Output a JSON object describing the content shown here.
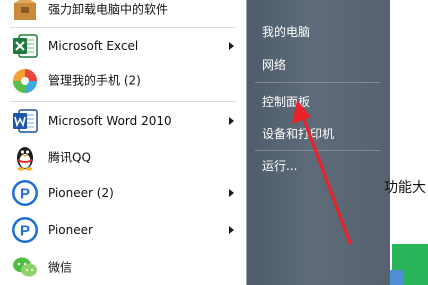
{
  "programs": [
    {
      "label": "强力卸载电脑中的软件",
      "icon": "uninstaller-box-icon",
      "has_arrow": false
    },
    {
      "label": "Microsoft Excel",
      "icon": "excel-icon",
      "has_arrow": true
    },
    {
      "label": "管理我的手机 (2)",
      "icon": "phone-manager-icon",
      "has_arrow": false
    },
    {
      "label": "Microsoft Word 2010",
      "icon": "word-icon",
      "has_arrow": true
    },
    {
      "label": "腾讯QQ",
      "icon": "qq-penguin-icon",
      "has_arrow": false
    },
    {
      "label": "Pioneer (2)",
      "icon": "pioneer-icon",
      "has_arrow": true
    },
    {
      "label": "Pioneer",
      "icon": "pioneer-icon",
      "has_arrow": true
    },
    {
      "label": "微信",
      "icon": "wechat-icon",
      "has_arrow": false
    }
  ],
  "right_menu": [
    {
      "label": "我的电脑"
    },
    {
      "label": "网络"
    },
    {
      "label": "控制面板"
    },
    {
      "label": "设备和打印机"
    },
    {
      "label": "运行..."
    }
  ],
  "background_doc": {
    "text": "功能大"
  },
  "colors": {
    "annotation_arrow": "#e8232a",
    "right_panel": "#56626f",
    "doc_green": "#28b55a"
  }
}
